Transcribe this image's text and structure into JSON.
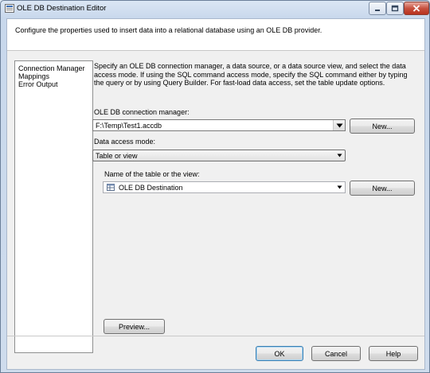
{
  "window": {
    "title": "OLE DB Destination Editor"
  },
  "header": {
    "description": "Configure the properties used to insert data into a relational database using an OLE DB provider."
  },
  "nav": {
    "items": [
      {
        "label": "Connection Manager"
      },
      {
        "label": "Mappings"
      },
      {
        "label": "Error Output"
      }
    ]
  },
  "main": {
    "instructions": "Specify an OLE DB connection manager, a data source, or a data source view, and select the data access mode. If using the SQL command access mode, specify the SQL command either by typing the query or by using Query Builder. For fast-load data access, set the table update options.",
    "connection_label": "OLE DB connection manager:",
    "connection_value": "F:\\Temp\\Test1.accdb",
    "new_connection_label": "New...",
    "access_mode_label": "Data access mode:",
    "access_mode_value": "Table or view",
    "table_label": "Name of the table or the view:",
    "table_value": "OLE DB Destination",
    "new_table_label": "New...",
    "preview_label": "Preview..."
  },
  "footer": {
    "ok_label": "OK",
    "cancel_label": "Cancel",
    "help_label": "Help"
  },
  "icons": {
    "app": "ssis-component-icon",
    "table": "table-icon"
  }
}
